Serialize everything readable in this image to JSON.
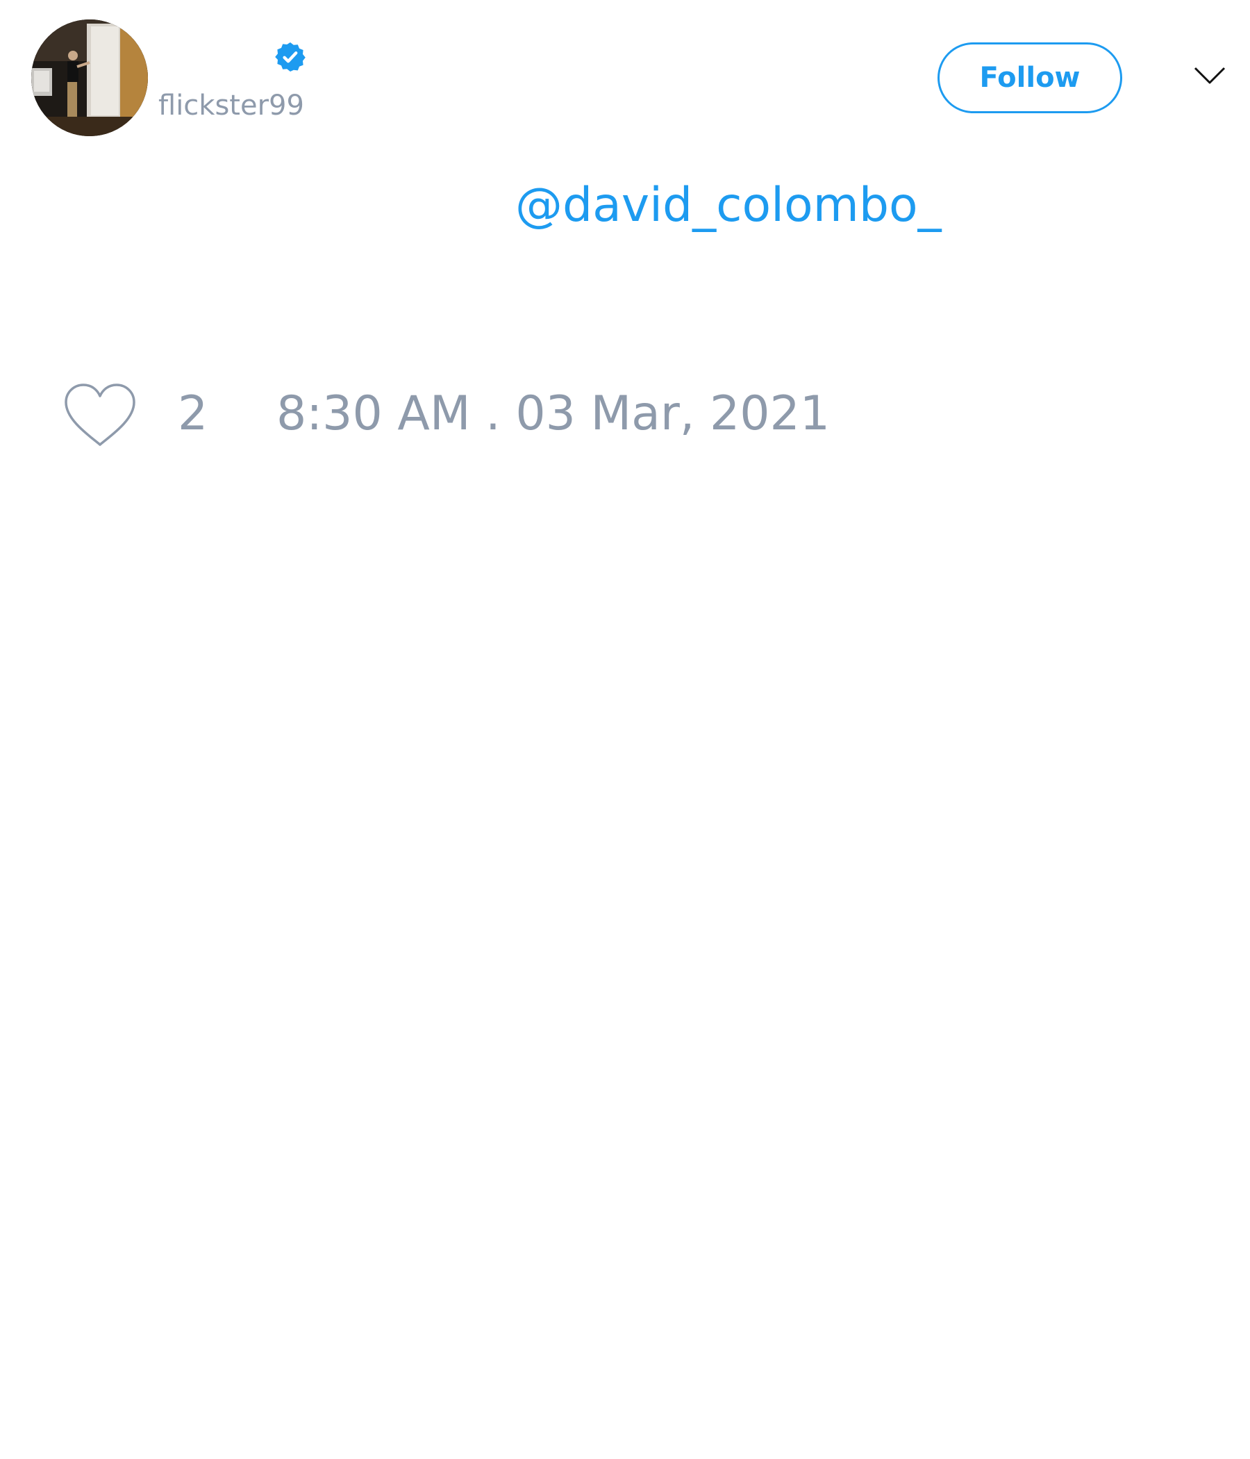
{
  "tweet": {
    "author": {
      "handle": "flickster99",
      "verified": true,
      "avatar_icon": "avatar-photo-presenter"
    },
    "follow_label": "Follow",
    "menu_icon": "chevron-down-icon",
    "mention": "@david_colombo_",
    "likes": "2",
    "like_icon": "heart-outline-icon",
    "timestamp": "8:30 AM . 03 Mar, 2021"
  },
  "colors": {
    "accent": "#1d9bf0",
    "muted_text": "#8e9aab",
    "background": "#ffffff"
  }
}
